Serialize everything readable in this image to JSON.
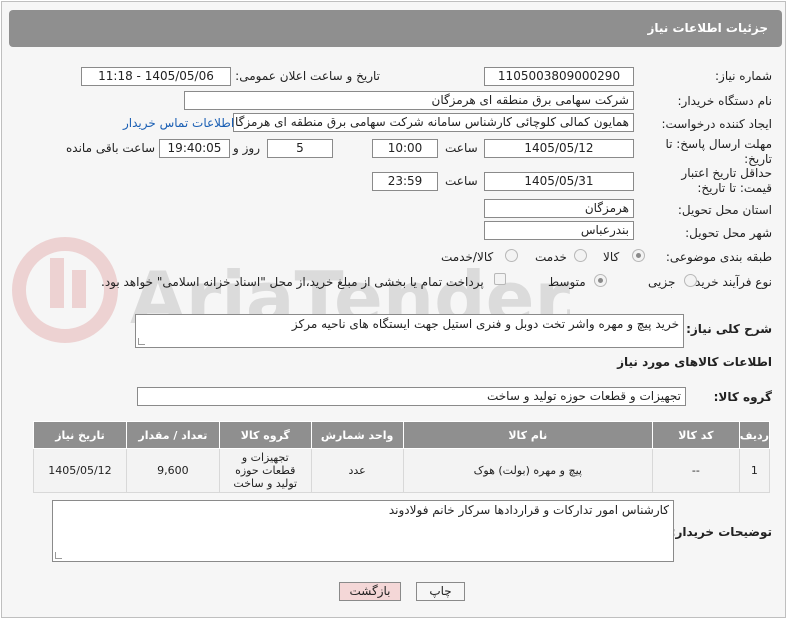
{
  "header": {
    "title": "جزئیات اطلاعات نیاز"
  },
  "fields": {
    "need_number_label": "شماره نیاز:",
    "need_number": "1105003809000290",
    "announce_label": "تاریخ و ساعت اعلان عمومی:",
    "announce_value": "1405/05/06 - 11:18",
    "buyer_org_label": "نام دستگاه خریدار:",
    "buyer_org": "شرکت سهامی برق منطقه ای هرمزگان",
    "requester_label": "ایجاد کننده درخواست:",
    "requester": "همایون کمالی کلوچائی کارشناس سامانه شرکت سهامی برق منطقه ای هرمزگان",
    "contact_link": "اطلاعات تماس خریدار",
    "deadline_label": "مهلت ارسال پاسخ: تا تاریخ:",
    "deadline_date": "1405/05/12",
    "time_label": "ساعت",
    "deadline_time": "10:00",
    "days_value": "5",
    "days_label": "روز و",
    "remaining_time": "19:40:05",
    "remaining_label": "ساعت باقی مانده",
    "min_validity_label": "حداقل تاریخ اعتبار قیمت: تا تاریخ:",
    "validity_date": "1405/05/31",
    "validity_time": "23:59",
    "province_label": "استان محل تحویل:",
    "province": "هرمزگان",
    "city_label": "شهر محل تحویل:",
    "city": "بندرعباس",
    "category_label": "طبقه بندی موضوعی:",
    "category_options": [
      "کالا",
      "خدمت",
      "کالا/خدمت"
    ],
    "purchase_type_label": "نوع فرآیند خرید :",
    "purchase_options": [
      "جزیی",
      "متوسط"
    ],
    "payment_note": "پرداخت تمام یا بخشی از مبلغ خرید،از محل \"اسناد خزانه اسلامی\" خواهد بود."
  },
  "summary": {
    "label": "شرح کلی نیاز:",
    "text": "خرید پیچ و مهره واشر تخت دوبل و فنری استیل جهت ایستگاه های ناحیه مرکز"
  },
  "goods_section": {
    "title": "اطلاعات کالاهای مورد نیاز",
    "group_label": "گروه کالا:",
    "group_value": "تجهیزات و قطعات حوزه تولید و ساخت"
  },
  "table": {
    "headers": [
      "ردیف",
      "کد کالا",
      "نام کالا",
      "واحد شمارش",
      "گروه کالا",
      "تعداد / مقدار",
      "تاریخ نیاز"
    ],
    "rows": [
      {
        "row": "1",
        "code": "--",
        "name": "پیچ و مهره (بولت) هوک",
        "unit": "عدد",
        "group": "تجهیزات و قطعات حوزه تولید و ساخت",
        "qty": "9,600",
        "date": "1405/05/12"
      }
    ]
  },
  "buyer_notes": {
    "label": "توضیحات خریدار:",
    "text": "کارشناس امور تدارکات و قراردادها سرکار خانم فولادوند"
  },
  "buttons": {
    "print": "چاپ",
    "back": "بازگشت"
  },
  "watermark": {
    "text": "AriaTender.neT"
  },
  "colors": {
    "header_bg": "#8f8f8f",
    "link": "#1a5fb4",
    "back_button_bg": "#f4d7d7"
  }
}
